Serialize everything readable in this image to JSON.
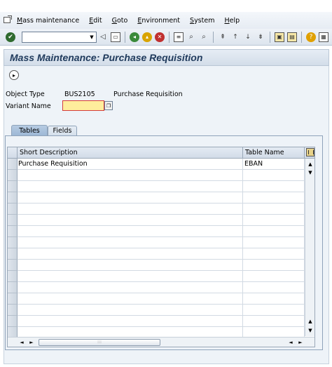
{
  "menu": {
    "items": [
      {
        "label": "Mass maintenance"
      },
      {
        "label": "Edit"
      },
      {
        "label": "Goto"
      },
      {
        "label": "Environment"
      },
      {
        "label": "System"
      },
      {
        "label": "Help"
      }
    ]
  },
  "toolbar": {
    "command_field_value": "",
    "icons": [
      "enter-icon",
      "back-icon",
      "save-icon",
      "back-nav-icon",
      "exit-icon",
      "cancel-icon",
      "print-icon",
      "find-icon",
      "find-next-icon",
      "first-page-icon",
      "prev-page-icon",
      "next-page-icon",
      "last-page-icon",
      "new-session-icon",
      "shortcut-icon",
      "help-icon",
      "layout-icon"
    ]
  },
  "page": {
    "title": "Mass Maintenance: Purchase Requisition"
  },
  "header_fields": {
    "object_type_label": "Object Type",
    "object_type_value": "BUS2105",
    "object_type_desc": "Purchase Requisition",
    "variant_label": "Variant Name",
    "variant_value": ""
  },
  "tabs": [
    {
      "label": "Tables",
      "active": true
    },
    {
      "label": "Fields",
      "active": false
    }
  ],
  "table": {
    "columns": [
      "Short Description",
      "Table Name"
    ],
    "rows": [
      {
        "description": "Purchase Requisition",
        "table_name": "EBAN"
      }
    ],
    "empty_row_count": 15,
    "scroll_thumb_label": ":::"
  },
  "colors": {
    "title_text": "#1f3a5c",
    "required_input_bg": "#ffed9c",
    "required_input_border": "#d43b3b",
    "active_tab": "#9db8d6"
  }
}
